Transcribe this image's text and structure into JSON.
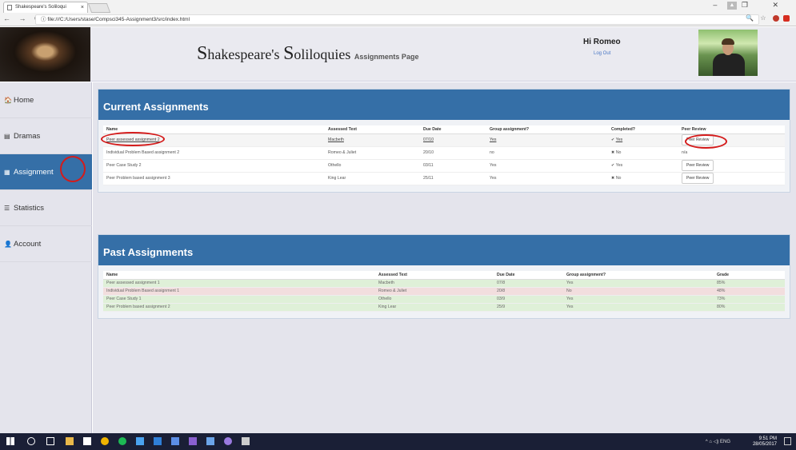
{
  "browser": {
    "tab_title": "Shakespeare's Soliloqui",
    "tab_close": "×",
    "url": "file:///C:/Users/stase/Compsci345-Assignment3/src/index.html",
    "nav_glyphs": "← → C",
    "info_icon": "ⓘ",
    "window_controls": "– ❐ ✕",
    "ext_glyphs": "🔍 ☆"
  },
  "header": {
    "title_S1": "S",
    "title_rest1": "hakespeare's ",
    "title_S2": "S",
    "title_rest2": "oliloquies",
    "subtitle": "Assignments Page",
    "greeting": "Hi Romeo",
    "logout": "Log Out"
  },
  "sidebar": {
    "items": [
      {
        "icon": "home-icon",
        "glyph": "🏠",
        "label": "Home"
      },
      {
        "icon": "film-icon",
        "glyph": "▤",
        "label": "Dramas"
      },
      {
        "icon": "calculator-icon",
        "glyph": "▦",
        "label": "Assignment"
      },
      {
        "icon": "stats-icon",
        "glyph": "☰",
        "label": "Statistics"
      },
      {
        "icon": "user-icon",
        "glyph": "👤",
        "label": "Account"
      }
    ]
  },
  "current": {
    "title": "Current Assignments",
    "headers": [
      "Name",
      "Assessed Text",
      "Due Date",
      "Group assignment?",
      "Completed?",
      "Peer Review"
    ],
    "rows": [
      {
        "name": "Peer assessed assignment 2",
        "text": "Macbeth",
        "due": "07/10",
        "group": "Yes",
        "completed_mark": "✔",
        "completed": "Yes",
        "peer": "Peer Review"
      },
      {
        "name": "Individual Problem Based assignment 2",
        "text": "Romeo & Juliet",
        "due": "20/10",
        "group": "no",
        "completed_mark": "✖",
        "completed": "No",
        "peer": "n/a"
      },
      {
        "name": "Peer Case Study 2",
        "text": "Othello",
        "due": "03/11",
        "group": "Yes",
        "completed_mark": "✔",
        "completed": "Yes",
        "peer": "Peer Review"
      },
      {
        "name": "Peer Problem based assignment 3",
        "text": "King Lear",
        "due": "25/11",
        "group": "Yes",
        "completed_mark": "✖",
        "completed": "No",
        "peer": "Peer Review"
      }
    ]
  },
  "past": {
    "title": "Past Assignments",
    "headers": [
      "Name",
      "Assessed Text",
      "Due Date",
      "Group assignment?",
      "Grade"
    ],
    "rows": [
      {
        "name": "Peer assessed assignment 1",
        "text": "Macbeth",
        "due": "07/8",
        "group": "Yes",
        "grade": "85%"
      },
      {
        "name": "Individual Problem Based assignment 1",
        "text": "Romeo & Juliet",
        "due": "20/8",
        "group": "No",
        "grade": "48%"
      },
      {
        "name": "Peer Case Study 1",
        "text": "Othello",
        "due": "03/9",
        "group": "Yes",
        "grade": "73%"
      },
      {
        "name": "Peer Problem based assignment 2",
        "text": "King Lear",
        "due": "25/9",
        "group": "Yes",
        "grade": "80%"
      }
    ]
  },
  "taskbar": {
    "time": "9:51 PM",
    "date": "28/05/2017",
    "lang": "ENG",
    "tray_glyphs": "^ ⌂ ◁)"
  },
  "colors": {
    "accent": "#356fa7",
    "annotation": "#d41b1b",
    "past_pass": "#dff0d8",
    "past_fail": "#f2dede"
  }
}
